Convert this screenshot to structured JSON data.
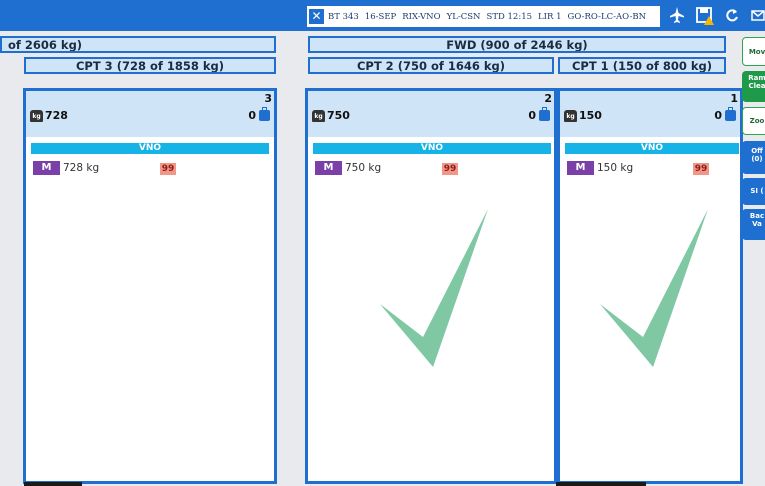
{
  "flight": {
    "close_label": "✕",
    "number": "BT 343",
    "date": "16-SEP",
    "route": "RIX-VNO",
    "registration": "YL-CSN",
    "std": "STD 12:15",
    "lir": "LIR 1",
    "status_codes": "GO-RO-LC-AO-BN"
  },
  "holds": {
    "aft": {
      "title": "of 2606 kg)"
    },
    "fwd": {
      "title": "FWD (900 of 2446 kg)"
    }
  },
  "compartments": [
    {
      "title": "CPT 3 (728 of 1858 kg)",
      "number": "3",
      "weight": "728",
      "bags": "0",
      "destination": "VNO",
      "uld_type": "M",
      "uld_weight": "728 kg",
      "priority": "99",
      "complete": false
    },
    {
      "title": "CPT 2 (750 of 1646 kg)",
      "number": "2",
      "weight": "750",
      "bags": "0",
      "destination": "VNO",
      "uld_type": "M",
      "uld_weight": "750 kg",
      "priority": "99",
      "complete": true
    },
    {
      "title": "CPT 1 (150 of 800 kg)",
      "number": "1",
      "weight": "150",
      "bags": "0",
      "destination": "VNO",
      "uld_type": "M",
      "uld_weight": "150 kg",
      "priority": "99",
      "complete": true
    }
  ],
  "icons": {
    "weight": "kg",
    "plane": "airplane-icon",
    "save": "save-warning-icon",
    "refresh": "refresh-icon",
    "mail": "mail-icon"
  },
  "sidebar": {
    "move": "Mov",
    "ramp_1": "Ram",
    "ramp_2": "Clea",
    "zoom": "Zoo",
    "offload_1": "Off",
    "offload_2": "(0)",
    "si": "SI (",
    "bag_1": "Bac",
    "bag_2": "Va"
  },
  "colors": {
    "accent": "#1f6fd0",
    "header_bg": "#cfe4f7",
    "destination": "#16b4e6",
    "uld_badge": "#7b3fa8",
    "priority": "#f3968a",
    "check": "#7fc8a3"
  }
}
